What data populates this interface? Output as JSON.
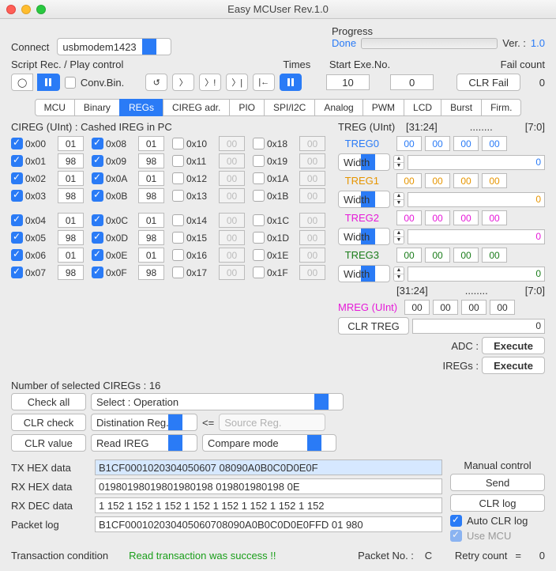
{
  "title": "Easy MCUser Rev.1.0",
  "connect": {
    "label": "Connect",
    "port": "usbmodem1423"
  },
  "progress": {
    "label": "Progress",
    "status": "Done"
  },
  "ver": {
    "label": "Ver. :",
    "value": "1.0"
  },
  "script": {
    "label": "Script Rec. / Play control",
    "convbin": "Conv.Bin.",
    "times_label": "Times",
    "times": "10",
    "start_label": "Start Exe.No.",
    "start": "0",
    "fail_label": "Fail count",
    "fail": "0",
    "clrfail": "CLR Fail"
  },
  "tabs": [
    "MCU",
    "Binary",
    "REGs",
    "CIREG adr.",
    "PIO",
    "SPI/I2C",
    "Analog",
    "PWM",
    "LCD",
    "Burst",
    "Firm."
  ],
  "cireg": {
    "title": "CIREG (UInt) : Cashed IREG in PC",
    "rows": [
      [
        {
          "a": "0x00",
          "v": "01",
          "c": true
        },
        {
          "a": "0x08",
          "v": "01",
          "c": true
        },
        {
          "a": "0x10",
          "v": "00",
          "c": false
        },
        {
          "a": "0x18",
          "v": "00",
          "c": false
        }
      ],
      [
        {
          "a": "0x01",
          "v": "98",
          "c": true
        },
        {
          "a": "0x09",
          "v": "98",
          "c": true
        },
        {
          "a": "0x11",
          "v": "00",
          "c": false
        },
        {
          "a": "0x19",
          "v": "00",
          "c": false
        }
      ],
      [
        {
          "a": "0x02",
          "v": "01",
          "c": true
        },
        {
          "a": "0x0A",
          "v": "01",
          "c": true
        },
        {
          "a": "0x12",
          "v": "00",
          "c": false
        },
        {
          "a": "0x1A",
          "v": "00",
          "c": false
        }
      ],
      [
        {
          "a": "0x03",
          "v": "98",
          "c": true
        },
        {
          "a": "0x0B",
          "v": "98",
          "c": true
        },
        {
          "a": "0x13",
          "v": "00",
          "c": false
        },
        {
          "a": "0x1B",
          "v": "00",
          "c": false
        }
      ],
      [
        {
          "a": "0x04",
          "v": "01",
          "c": true
        },
        {
          "a": "0x0C",
          "v": "01",
          "c": true
        },
        {
          "a": "0x14",
          "v": "00",
          "c": false
        },
        {
          "a": "0x1C",
          "v": "00",
          "c": false
        }
      ],
      [
        {
          "a": "0x05",
          "v": "98",
          "c": true
        },
        {
          "a": "0x0D",
          "v": "98",
          "c": true
        },
        {
          "a": "0x15",
          "v": "00",
          "c": false
        },
        {
          "a": "0x1D",
          "v": "00",
          "c": false
        }
      ],
      [
        {
          "a": "0x06",
          "v": "01",
          "c": true
        },
        {
          "a": "0x0E",
          "v": "01",
          "c": true
        },
        {
          "a": "0x16",
          "v": "00",
          "c": false
        },
        {
          "a": "0x1E",
          "v": "00",
          "c": false
        }
      ],
      [
        {
          "a": "0x07",
          "v": "98",
          "c": true
        },
        {
          "a": "0x0F",
          "v": "98",
          "c": true
        },
        {
          "a": "0x17",
          "v": "00",
          "c": false
        },
        {
          "a": "0x1F",
          "v": "00",
          "c": false
        }
      ]
    ],
    "selcount": "Number of selected CIREGs :  16",
    "checkall": "Check all",
    "selop": "Select : Operation",
    "clrcheck": "CLR check",
    "dstreg": "Distination Reg.",
    "arrow": "<=",
    "srcreg": "Source Reg.",
    "clrvalue": "CLR value",
    "readireg": "Read IREG",
    "compare": "Compare mode"
  },
  "treg": {
    "title": "TREG (UInt)",
    "hdr1": "[31:24]",
    "dots": "........",
    "hdr2": "[7:0]",
    "regs": [
      {
        "name": "TREG0",
        "cls": "blue-t",
        "b": [
          "00",
          "00",
          "00",
          "00"
        ],
        "w": "0"
      },
      {
        "name": "TREG1",
        "cls": "orange-t",
        "b": [
          "00",
          "00",
          "00",
          "00"
        ],
        "w": "0"
      },
      {
        "name": "TREG2",
        "cls": "magenta-t",
        "b": [
          "00",
          "00",
          "00",
          "00"
        ],
        "w": "0"
      },
      {
        "name": "TREG3",
        "cls": "darkgreen-t",
        "b": [
          "00",
          "00",
          "00",
          "00"
        ],
        "w": "0"
      }
    ],
    "width": "Width",
    "mreg": "MREG (UInt)",
    "mregb": [
      "00",
      "00",
      "00",
      "00"
    ],
    "clrtreg": "CLR TREG",
    "mregval": "0",
    "adc": "ADC :",
    "iregs": "IREGs :",
    "execute": "Execute"
  },
  "data": {
    "txhex_l": "TX HEX data",
    "txhex": "B1CF0001020304050607 08090A0B0C0D0E0F",
    "rxhex_l": "RX HEX data",
    "rxhex": "01980198019801980198 019801980198 0E",
    "rxdec_l": "RX DEC data",
    "rxdec": "1 152 1 152 1 152 1 152 1 152 1 152 1 152 1 152",
    "pktlog_l": "Packet log",
    "pktlog": "B1CF000102030405060708090A0B0C0D0E0FFD 01 980"
  },
  "manual": {
    "label": "Manual control",
    "send": "Send",
    "clrlog": "CLR log",
    "autoclr": "Auto CLR log",
    "usemcu": "Use MCU"
  },
  "footer": {
    "trans": "Transaction condition",
    "msg": "Read transaction was success !!",
    "pktno_l": "Packet No. :",
    "pktno": "C",
    "retry_l": "Retry count",
    "eq": "=",
    "retry": "0"
  }
}
